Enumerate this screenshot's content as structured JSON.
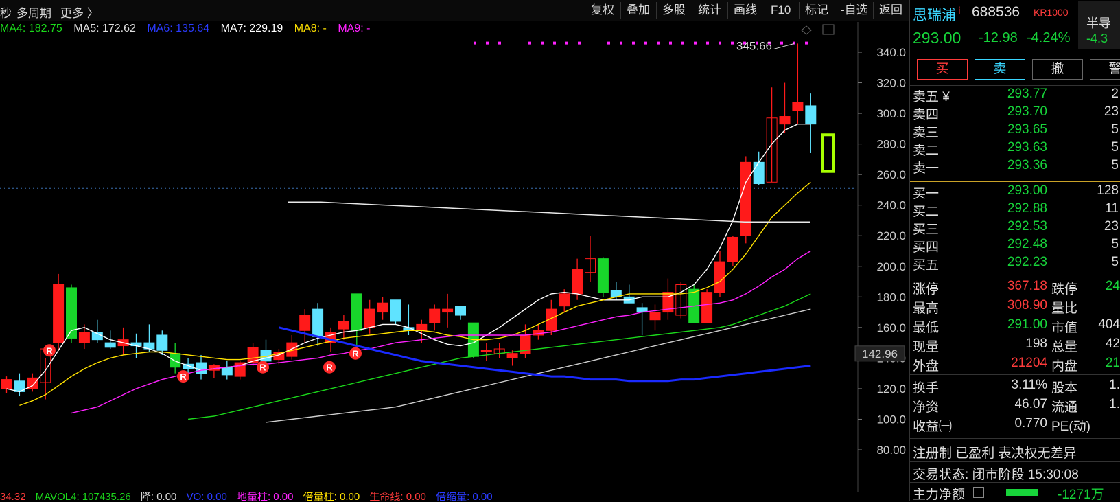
{
  "topbar": {
    "left_items": [
      "秒",
      "多周期",
      "更多 〉"
    ],
    "buttons": [
      "复权",
      "叠加",
      "多股",
      "统计",
      "画线",
      "F10",
      "标记",
      "-自选",
      "返回"
    ]
  },
  "ma_legend": [
    {
      "label": "MA4: 182.75",
      "color": "#1bd81b"
    },
    {
      "label": "MA5: 172.62",
      "color": "#dddddd"
    },
    {
      "label": "MA6: 135.64",
      "color": "#2a3bff"
    },
    {
      "label": "MA7: 229.19",
      "color": "#ffffff"
    },
    {
      "label": "MA8: -",
      "color": "#ffe100"
    },
    {
      "label": "MA9: -",
      "color": "#ff22ff"
    }
  ],
  "chart_data": {
    "type": "candlestick",
    "ylim": [
      75,
      350
    ],
    "y_ticks": [
      "340.0",
      "320.0",
      "300.0",
      "280.0",
      "260.0",
      "240.0",
      "220.0",
      "200.0",
      "180.0",
      "160.0",
      "140.0",
      "120.0",
      "100.0",
      "80.00"
    ],
    "price_marker": "142.96",
    "high_annotation": "345.66",
    "candles": [
      {
        "o": 120,
        "h": 128,
        "l": 117,
        "c": 126,
        "dir": "up"
      },
      {
        "o": 125,
        "h": 130,
        "l": 115,
        "c": 118,
        "dir": "down"
      },
      {
        "o": 120,
        "h": 130,
        "l": 118,
        "c": 127,
        "dir": "down"
      },
      {
        "o": 124,
        "h": 140,
        "l": 113,
        "c": 146,
        "dir": "down"
      },
      {
        "o": 150,
        "h": 195,
        "l": 145,
        "c": 188,
        "dir": "down"
      },
      {
        "o": 186,
        "h": 188,
        "l": 150,
        "c": 153,
        "dir": "up"
      },
      {
        "o": 150,
        "h": 162,
        "l": 146,
        "c": 157,
        "dir": "down"
      },
      {
        "o": 157,
        "h": 165,
        "l": 150,
        "c": 152,
        "dir": "up"
      },
      {
        "o": 150,
        "h": 158,
        "l": 146,
        "c": 147,
        "dir": "up"
      },
      {
        "o": 148,
        "h": 160,
        "l": 142,
        "c": 152,
        "dir": "up"
      },
      {
        "o": 150,
        "h": 156,
        "l": 140,
        "c": 148,
        "dir": "up"
      },
      {
        "o": 150,
        "h": 162,
        "l": 144,
        "c": 146,
        "dir": "down"
      },
      {
        "o": 155,
        "h": 158,
        "l": 142,
        "c": 145,
        "dir": "up"
      },
      {
        "o": 143,
        "h": 150,
        "l": 130,
        "c": 134,
        "dir": "up"
      },
      {
        "o": 136,
        "h": 140,
        "l": 128,
        "c": 133,
        "dir": "down"
      },
      {
        "o": 137,
        "h": 142,
        "l": 126,
        "c": 130,
        "dir": "up"
      },
      {
        "o": 132,
        "h": 136,
        "l": 127,
        "c": 135,
        "dir": "down"
      },
      {
        "o": 134,
        "h": 138,
        "l": 126,
        "c": 129,
        "dir": "up"
      },
      {
        "o": 128,
        "h": 138,
        "l": 126,
        "c": 137,
        "dir": "down"
      },
      {
        "o": 137,
        "h": 150,
        "l": 135,
        "c": 147,
        "dir": "down"
      },
      {
        "o": 145,
        "h": 152,
        "l": 136,
        "c": 138,
        "dir": "up"
      },
      {
        "o": 139,
        "h": 146,
        "l": 136,
        "c": 144,
        "dir": "down"
      },
      {
        "o": 141,
        "h": 155,
        "l": 139,
        "c": 150,
        "dir": "down"
      },
      {
        "o": 158,
        "h": 172,
        "l": 150,
        "c": 168,
        "dir": "down"
      },
      {
        "o": 172,
        "h": 176,
        "l": 148,
        "c": 154,
        "dir": "up"
      },
      {
        "o": 150,
        "h": 160,
        "l": 144,
        "c": 157,
        "dir": "down"
      },
      {
        "o": 159,
        "h": 168,
        "l": 152,
        "c": 164,
        "dir": "down"
      },
      {
        "o": 182,
        "h": 182,
        "l": 148,
        "c": 158,
        "dir": "up"
      },
      {
        "o": 160,
        "h": 178,
        "l": 156,
        "c": 172,
        "dir": "down"
      },
      {
        "o": 170,
        "h": 180,
        "l": 165,
        "c": 176,
        "dir": "down"
      },
      {
        "o": 178,
        "h": 178,
        "l": 162,
        "c": 164,
        "dir": "up"
      },
      {
        "o": 160,
        "h": 175,
        "l": 155,
        "c": 158,
        "dir": "up"
      },
      {
        "o": 158,
        "h": 165,
        "l": 150,
        "c": 162,
        "dir": "down"
      },
      {
        "o": 163,
        "h": 175,
        "l": 158,
        "c": 172,
        "dir": "down"
      },
      {
        "o": 170,
        "h": 182,
        "l": 160,
        "c": 172,
        "dir": "down"
      },
      {
        "o": 174,
        "h": 174,
        "l": 165,
        "c": 168,
        "dir": "up"
      },
      {
        "o": 163,
        "h": 163,
        "l": 140,
        "c": 141,
        "dir": "up"
      },
      {
        "o": 145,
        "h": 150,
        "l": 138,
        "c": 145,
        "dir": "up"
      },
      {
        "o": 143,
        "h": 150,
        "l": 140,
        "c": 146,
        "dir": "up"
      },
      {
        "o": 140,
        "h": 145,
        "l": 135,
        "c": 143,
        "dir": "up"
      },
      {
        "o": 143,
        "h": 162,
        "l": 140,
        "c": 155,
        "dir": "down"
      },
      {
        "o": 155,
        "h": 162,
        "l": 152,
        "c": 158,
        "dir": "down"
      },
      {
        "o": 158,
        "h": 178,
        "l": 155,
        "c": 172,
        "dir": "down"
      },
      {
        "o": 174,
        "h": 185,
        "l": 170,
        "c": 182,
        "dir": "down"
      },
      {
        "o": 182,
        "h": 205,
        "l": 178,
        "c": 198,
        "dir": "down"
      },
      {
        "o": 196,
        "h": 220,
        "l": 190,
        "c": 205,
        "dir": "down"
      },
      {
        "o": 205,
        "h": 206,
        "l": 180,
        "c": 183,
        "dir": "up"
      },
      {
        "o": 184,
        "h": 190,
        "l": 178,
        "c": 180,
        "dir": "up"
      },
      {
        "o": 180,
        "h": 188,
        "l": 176,
        "c": 176,
        "dir": "up"
      },
      {
        "o": 173,
        "h": 176,
        "l": 155,
        "c": 170,
        "dir": "up"
      },
      {
        "o": 165,
        "h": 175,
        "l": 158,
        "c": 170,
        "dir": "down"
      },
      {
        "o": 170,
        "h": 192,
        "l": 165,
        "c": 183,
        "dir": "down"
      },
      {
        "o": 168,
        "h": 190,
        "l": 166,
        "c": 188,
        "dir": "down"
      },
      {
        "o": 185,
        "h": 188,
        "l": 163,
        "c": 163,
        "dir": "up"
      },
      {
        "o": 163,
        "h": 185,
        "l": 163,
        "c": 183,
        "dir": "down"
      },
      {
        "o": 183,
        "h": 210,
        "l": 180,
        "c": 203,
        "dir": "down"
      },
      {
        "o": 203,
        "h": 220,
        "l": 200,
        "c": 219,
        "dir": "down"
      },
      {
        "o": 220,
        "h": 272,
        "l": 215,
        "c": 268,
        "dir": "down"
      },
      {
        "o": 268,
        "h": 275,
        "l": 253,
        "c": 254,
        "dir": "up"
      },
      {
        "o": 255,
        "h": 317,
        "l": 255,
        "c": 297,
        "dir": "down"
      },
      {
        "o": 293,
        "h": 320,
        "l": 287,
        "c": 298,
        "dir": "down"
      },
      {
        "o": 302,
        "h": 345.66,
        "l": 293,
        "c": 307,
        "dir": "down"
      },
      {
        "o": 305,
        "h": 313,
        "l": 274,
        "c": 293,
        "dir": "up"
      }
    ],
    "ma_lines": {
      "white_ma": [
        120,
        118,
        122,
        132,
        145,
        158,
        160,
        156,
        152,
        150,
        148,
        146,
        143,
        138,
        135,
        132,
        133,
        134,
        135,
        138,
        140,
        142,
        146,
        150,
        153,
        155,
        157,
        158,
        160,
        162,
        162,
        160,
        156,
        152,
        149,
        148,
        150,
        155,
        160,
        166,
        172,
        178,
        182,
        183,
        182,
        180,
        178,
        178,
        178,
        180,
        180,
        180,
        183,
        188,
        198,
        212,
        230,
        255,
        268,
        280,
        289,
        293,
        293
      ],
      "yellow_ma": [
        109,
        112,
        116,
        122,
        128,
        133,
        137,
        140,
        142,
        143,
        144,
        144,
        143,
        142,
        141,
        140,
        139,
        139,
        140,
        141,
        143,
        145,
        147,
        149,
        151,
        153,
        154,
        155,
        156,
        157,
        158,
        158,
        157,
        155,
        154,
        152,
        152,
        153,
        155,
        158,
        162,
        166,
        170,
        174,
        176,
        178,
        180,
        182,
        182,
        182,
        182,
        182,
        183,
        186,
        190,
        198,
        208,
        220,
        232,
        240,
        248,
        255
      ],
      "magenta_ma": [
        104,
        106,
        108,
        112,
        116,
        120,
        123,
        126,
        128,
        130,
        132,
        133,
        134,
        135,
        136,
        136,
        137,
        138,
        139,
        140,
        142,
        143,
        145,
        146,
        148,
        150,
        151,
        152,
        153,
        154,
        155,
        155,
        155,
        155,
        155,
        155,
        156,
        157,
        159,
        161,
        163,
        165,
        167,
        168,
        170,
        171,
        172,
        173,
        174,
        175,
        176,
        178,
        182,
        187,
        193,
        198,
        205,
        210
      ],
      "green_ma": [
        100,
        101,
        102,
        104,
        106,
        108,
        110,
        112,
        114,
        116,
        118,
        120,
        122,
        124,
        126,
        128,
        130,
        132,
        134,
        136,
        138,
        140,
        141,
        142,
        143,
        144,
        145,
        146,
        147,
        148,
        149,
        150,
        151,
        152,
        153,
        154,
        155,
        156,
        157,
        158,
        159,
        160,
        162,
        165,
        168,
        171,
        174,
        178,
        182
      ],
      "gray_ma": [
        98,
        99,
        100,
        101,
        102,
        103,
        104,
        105,
        106,
        107,
        108,
        110,
        112,
        114,
        116,
        118,
        120,
        122,
        124,
        126,
        128,
        130,
        132,
        134,
        136,
        138,
        140,
        142,
        144,
        146,
        148,
        150,
        152,
        154,
        156,
        158,
        160,
        162,
        164,
        166,
        168,
        170,
        172
      ],
      "blue_ma": [
        160,
        158,
        156,
        154,
        152,
        150,
        148,
        146,
        144,
        142,
        140,
        138,
        137,
        136,
        135,
        134,
        133,
        132,
        131,
        130,
        129,
        128,
        128,
        127,
        126,
        126,
        126,
        125,
        125,
        125,
        125,
        126,
        126,
        127,
        128,
        129,
        130,
        131,
        132,
        133,
        134,
        135
      ],
      "flat_ma": [
        242,
        242,
        241,
        240,
        239,
        238,
        237,
        236,
        235,
        234,
        233,
        232,
        231,
        230,
        229,
        229,
        229
      ]
    }
  },
  "bottombar": [
    {
      "text": "34.32",
      "color": "#ff3b3b"
    },
    {
      "text": "MAVOL4: 107435.26",
      "color": "#1bd81b"
    },
    {
      "text": "降: 0.00",
      "color": "#dddddd"
    },
    {
      "text": "VO: 0.00",
      "color": "#2a3bff"
    },
    {
      "text": "地量柱: 0.00",
      "color": "#ff22ff"
    },
    {
      "text": "倍量柱: 0.00",
      "color": "#ffe100"
    },
    {
      "text": "生命线: 0.00",
      "color": "#ff3b3b"
    },
    {
      "text": "倍缩量: 0.00",
      "color": "#2a3bff"
    }
  ],
  "panel": {
    "name": "思瑞浦",
    "code": "688536",
    "tag": "KR1000",
    "extra": "半导",
    "extra_pct": "-4.3",
    "price": "293.00",
    "change": "-12.98",
    "pct": "-4.24%",
    "buy": "买",
    "sell": "卖",
    "cancel": "撤",
    "alert": "警",
    "asks": [
      {
        "label": "卖五 ¥",
        "price": "293.77",
        "vol": "2"
      },
      {
        "label": "卖四",
        "price": "293.70",
        "vol": "23"
      },
      {
        "label": "卖三",
        "price": "293.65",
        "vol": "5"
      },
      {
        "label": "卖二",
        "price": "293.63",
        "vol": "5"
      },
      {
        "label": "卖一",
        "price": "293.36",
        "vol": "5"
      }
    ],
    "bids": [
      {
        "label": "买一",
        "price": "293.00",
        "vol": "128"
      },
      {
        "label": "买二",
        "price": "292.88",
        "vol": "11"
      },
      {
        "label": "买三",
        "price": "292.53",
        "vol": "23"
      },
      {
        "label": "买四",
        "price": "292.48",
        "vol": "5"
      },
      {
        "label": "买五",
        "price": "292.23",
        "vol": "5"
      }
    ],
    "stats": [
      {
        "l1": "涨停",
        "v1": "367.18",
        "c1": "red",
        "l2": "跌停",
        "v2": "24",
        "c2": "green"
      },
      {
        "l1": "最高",
        "v1": "308.90",
        "c1": "red",
        "l2": "量比",
        "v2": "",
        "c2": "gray"
      },
      {
        "l1": "最低",
        "v1": "291.00",
        "c1": "green",
        "l2": "市值",
        "v2": "404",
        "c2": "gray"
      },
      {
        "l1": "现量",
        "v1": "198",
        "c1": "gray",
        "l2": "总量",
        "v2": "42",
        "c2": "gray"
      },
      {
        "l1": "外盘",
        "v1": "21204",
        "c1": "red",
        "l2": "内盘",
        "v2": "21",
        "c2": "green"
      }
    ],
    "stats2": [
      {
        "l1": "换手",
        "v1": "3.11%",
        "l2": "股本",
        "v2": "1."
      },
      {
        "l1": "净资",
        "v1": "46.07",
        "l2": "流通",
        "v2": "1."
      },
      {
        "l1": "收益㈠",
        "v1": "0.770",
        "l2": "PE(动)",
        "v2": ""
      }
    ],
    "reg_note": "注册制 已盈利 表决权无差异",
    "status": "交易状态: 闭市阶段 15:30:08",
    "main_flow_label": "主力净额",
    "main_flow_val": "-1271万"
  }
}
